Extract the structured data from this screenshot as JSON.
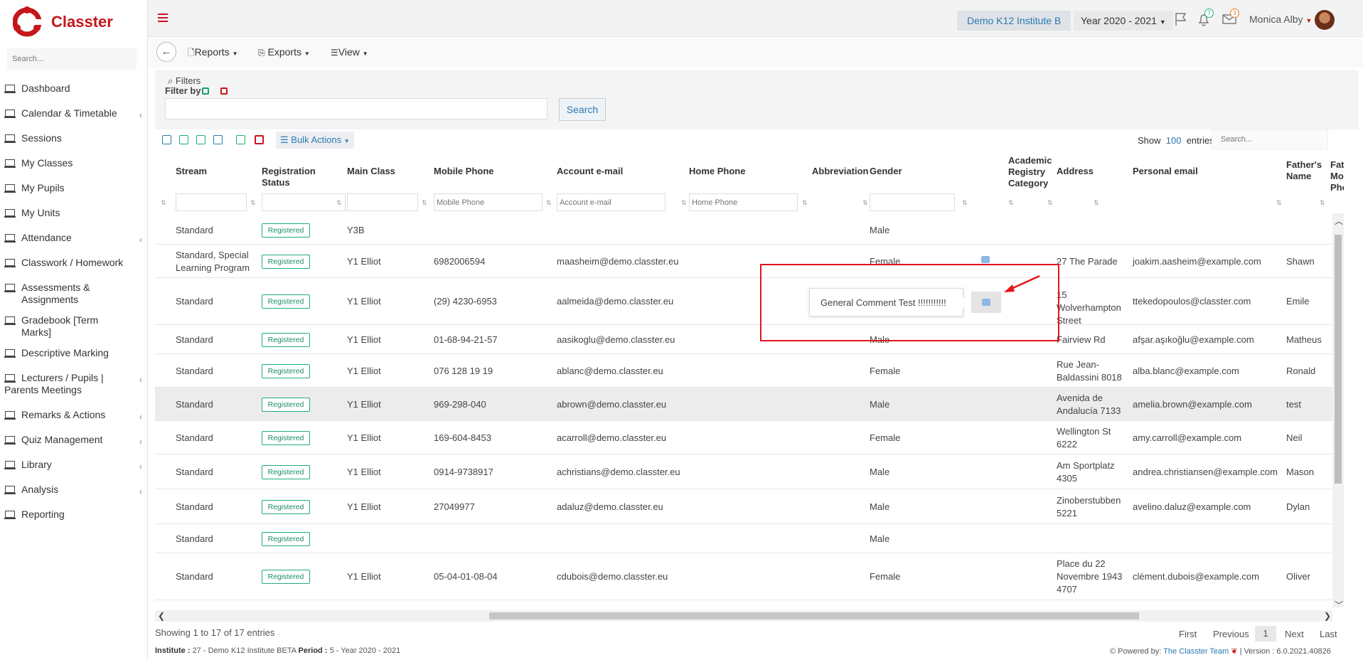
{
  "brand": {
    "name": "Classter"
  },
  "sidebar": {
    "search_placeholder": "Search...",
    "items": [
      {
        "label": "Dashboard",
        "icon": "laptop-icon",
        "expandable": false
      },
      {
        "label": "Calendar & Timetable",
        "icon": "calendar-icon",
        "expandable": true
      },
      {
        "label": "Sessions",
        "icon": "sessions-icon",
        "expandable": false
      },
      {
        "label": "My Classes",
        "icon": "classes-icon",
        "expandable": false
      },
      {
        "label": "My Pupils",
        "icon": "pupils-icon",
        "expandable": false
      },
      {
        "label": "My Units",
        "icon": "book-icon",
        "expandable": false
      },
      {
        "label": "Attendance",
        "icon": "attendance-icon",
        "expandable": true
      },
      {
        "label": "Classwork / Homework",
        "icon": "list-icon",
        "expandable": false
      },
      {
        "label": "Assessments & Assignments",
        "icon": "edit-icon",
        "expandable": false
      },
      {
        "label": "Gradebook [Term Marks]",
        "icon": "gradebook-icon",
        "expandable": false
      },
      {
        "label": "Descriptive Marking",
        "icon": "marking-icon",
        "expandable": false
      },
      {
        "label": "Lecturers / Pupils | Parents Meetings",
        "icon": "meetings-icon",
        "expandable": true
      },
      {
        "label": "Remarks & Actions",
        "icon": "remarks-icon",
        "expandable": true
      },
      {
        "label": "Quiz Management",
        "icon": "quiz-icon",
        "expandable": true
      },
      {
        "label": "Library",
        "icon": "library-icon",
        "expandable": true
      },
      {
        "label": "Analysis",
        "icon": "chart-icon",
        "expandable": true
      },
      {
        "label": "Reporting",
        "icon": "printer-icon",
        "expandable": false
      }
    ]
  },
  "topbar": {
    "institute": "Demo K12 Institute B",
    "year": "Year 2020 - 2021",
    "notifications_count": "7",
    "messages_count": "3",
    "user": "Monica Alby"
  },
  "toolbar": {
    "reports": "Reports",
    "exports": "Exports",
    "view": "View"
  },
  "filters": {
    "title": "Filters",
    "filter_by": "Filter by",
    "search_button": "Search"
  },
  "table_controls": {
    "bulk_actions": "Bulk Actions",
    "show_label": "Show",
    "entries_count": "100",
    "entries_label": "entries",
    "search_placeholder": "Search..."
  },
  "table": {
    "columns": [
      "Stream",
      "Registration Status",
      "Main Class",
      "Mobile Phone",
      "Account e-mail",
      "Home Phone",
      "Abbreviation",
      "Gender",
      "Academic Registry Category",
      "Address",
      "Personal email",
      "Father's Name",
      "Fath Mob Pho"
    ],
    "filter_placeholders": {
      "mobile": "Mobile Phone",
      "email": "Account e-mail",
      "home": "Home Phone"
    },
    "rows": [
      {
        "stream": "Standard",
        "status": "Registered",
        "class": "Y3B",
        "mobile": "",
        "email": "",
        "gender": "Male",
        "address": "",
        "personal": "",
        "father": ""
      },
      {
        "stream": "Standard, Special Learning Program",
        "status": "Registered",
        "class": "Y1 Elliot",
        "mobile": "6982006594",
        "email": "maasheim@demo.classter.eu",
        "gender": "Female",
        "address": "27 The Parade",
        "personal": "joakim.aasheim@example.com",
        "father": "Shawn"
      },
      {
        "stream": "Standard",
        "status": "Registered",
        "class": "Y1 Elliot",
        "mobile": "(29) 4230-6953",
        "email": "aalmeida@demo.classter.eu",
        "gender": "",
        "address": "15 Wolverhampton Street",
        "personal": "ttekedopoulos@classter.com",
        "father": "Emile"
      },
      {
        "stream": "Standard",
        "status": "Registered",
        "class": "Y1 Elliot",
        "mobile": "01-68-94-21-57",
        "email": "aasikoglu@demo.classter.eu",
        "gender": "Male",
        "address": "Fairview Rd",
        "personal": "afşar.aşıkoğlu@example.com",
        "father": "Matheus"
      },
      {
        "stream": "Standard",
        "status": "Registered",
        "class": "Y1 Elliot",
        "mobile": "076 128 19 19",
        "email": "ablanc@demo.classter.eu",
        "gender": "Female",
        "address": "Rue Jean-Baldassini 8018",
        "personal": "alba.blanc@example.com",
        "father": "Ronald"
      },
      {
        "stream": "Standard",
        "status": "Registered",
        "class": "Y1 Elliot",
        "mobile": "969-298-040",
        "email": "abrown@demo.classter.eu",
        "gender": "Male",
        "address": "Avenida de Andalucía 7133",
        "personal": "amelia.brown@example.com",
        "father": "test"
      },
      {
        "stream": "Standard",
        "status": "Registered",
        "class": "Y1 Elliot",
        "mobile": "169-604-8453",
        "email": "acarroll@demo.classter.eu",
        "gender": "Female",
        "address": "Wellington St 6222",
        "personal": "amy.carroll@example.com",
        "father": "Neil"
      },
      {
        "stream": "Standard",
        "status": "Registered",
        "class": "Y1 Elliot",
        "mobile": "0914-9738917",
        "email": "achristians@demo.classter.eu",
        "gender": "Male",
        "address": "Am Sportplatz 4305",
        "personal": "andrea.christiansen@example.com",
        "father": "Mason"
      },
      {
        "stream": "Standard",
        "status": "Registered",
        "class": "Y1 Elliot",
        "mobile": "27049977",
        "email": "adaluz@demo.classter.eu",
        "gender": "Male",
        "address": "Zinoberstubben 5221",
        "personal": "avelino.daluz@example.com",
        "father": "Dylan"
      },
      {
        "stream": "Standard",
        "status": "Registered",
        "class": "",
        "mobile": "",
        "email": "",
        "gender": "Male",
        "address": "",
        "personal": "",
        "father": ""
      },
      {
        "stream": "Standard",
        "status": "Registered",
        "class": "Y1 Elliot",
        "mobile": "05-04-01-08-04",
        "email": "cdubois@demo.classter.eu",
        "gender": "Female",
        "address": "Place du 22 Novembre 1943 4707",
        "personal": "clément.dubois@example.com",
        "father": "Oliver"
      }
    ],
    "comment_popup": "General Comment Test !!!!!!!!!!!"
  },
  "pagination": {
    "info": "Showing 1 to 17 of 17 entries",
    "first": "First",
    "previous": "Previous",
    "current": "1",
    "next": "Next",
    "last": "Last"
  },
  "footer": {
    "institute_label": "Institute :",
    "institute_value": "27 - Demo K12 Institute BETA",
    "period_label": "Period :",
    "period_value": "5 - Year 2020 - 2021",
    "powered": "Powered by:",
    "team": "The Classter Team",
    "version": "| Version : 6.0.2021.40826"
  },
  "colors": {
    "brand_red": "#c4161c",
    "link_blue": "#2a7ab0",
    "registered_green": "#1fae7a",
    "annotation_red": "#e3151b"
  }
}
